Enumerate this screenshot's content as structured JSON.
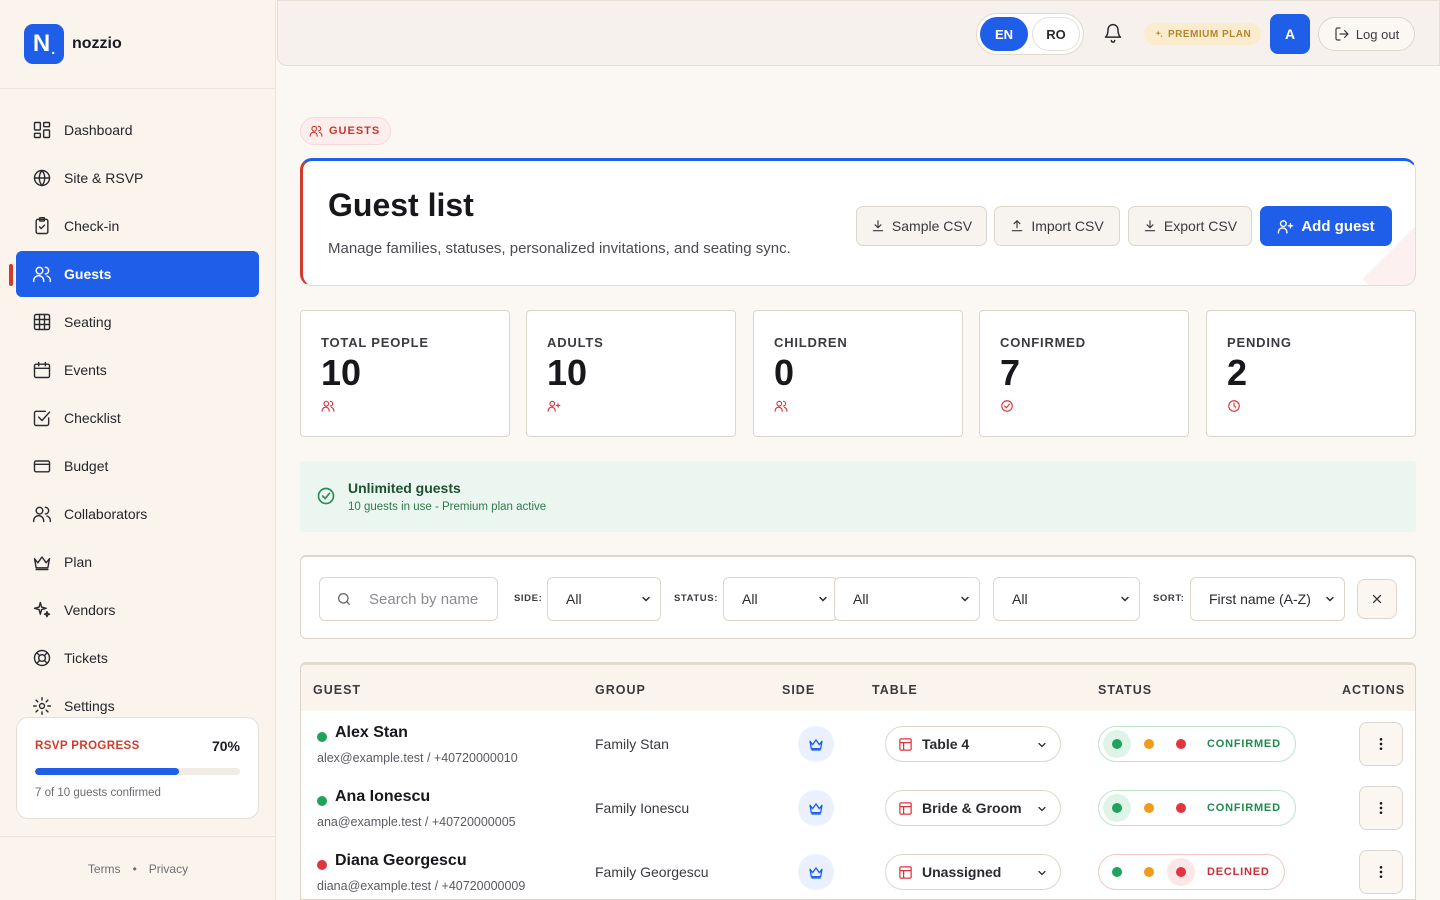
{
  "brand": {
    "logo_letter": "N",
    "name": "nozzio"
  },
  "sidebar": {
    "items": [
      {
        "label": "Dashboard",
        "icon": "dashboard-icon"
      },
      {
        "label": "Site & RSVP",
        "icon": "globe-icon"
      },
      {
        "label": "Check-in",
        "icon": "clipboard-check-icon"
      },
      {
        "label": "Guests",
        "icon": "users-icon",
        "active": true
      },
      {
        "label": "Seating",
        "icon": "grid-icon"
      },
      {
        "label": "Events",
        "icon": "calendar-icon"
      },
      {
        "label": "Checklist",
        "icon": "checkbox-icon"
      },
      {
        "label": "Budget",
        "icon": "wallet-icon"
      },
      {
        "label": "Collaborators",
        "icon": "users-icon"
      },
      {
        "label": "Plan",
        "icon": "crown-icon"
      },
      {
        "label": "Vendors",
        "icon": "sparkles-icon"
      },
      {
        "label": "Tickets",
        "icon": "lifebuoy-icon"
      },
      {
        "label": "Settings",
        "icon": "gear-icon"
      }
    ],
    "rsvp": {
      "label": "RSVP PROGRESS",
      "percent_text": "70%",
      "progress": 0.7,
      "subtitle": "7 of 10 guests confirmed"
    },
    "footer": {
      "terms": "Terms",
      "separator": "•",
      "privacy": "Privacy"
    }
  },
  "topbar": {
    "lang_en": "EN",
    "lang_ro": "RO",
    "premium_badge": "PREMIUM PLAN",
    "avatar_initial": "A",
    "logout_label": "Log out"
  },
  "page": {
    "breadcrumb": "GUESTS",
    "title": "Guest list",
    "subtitle": "Manage families, statuses, personalized invitations, and seating sync.",
    "buttons": {
      "sample_csv": "Sample CSV",
      "import_csv": "Import CSV",
      "export_csv": "Export CSV",
      "add_guest": "Add guest"
    }
  },
  "stats": [
    {
      "label": "TOTAL PEOPLE",
      "value": "10",
      "icon": "users-icon"
    },
    {
      "label": "ADULTS",
      "value": "10",
      "icon": "user-plus-icon"
    },
    {
      "label": "CHILDREN",
      "value": "0",
      "icon": "users-icon"
    },
    {
      "label": "CONFIRMED",
      "value": "7",
      "icon": "check-circle-icon"
    },
    {
      "label": "PENDING",
      "value": "2",
      "icon": "clock-icon"
    }
  ],
  "notice": {
    "title": "Unlimited guests",
    "subtitle": "10 guests in use - Premium plan active"
  },
  "filters": {
    "search_placeholder": "Search by name",
    "side_label": "SIDE:",
    "side_value": "All",
    "status_label": "STATUS:",
    "status_value": "All",
    "filter3_value": "All",
    "filter4_value": "All",
    "sort_label": "SORT:",
    "sort_value": "First name (A-Z)"
  },
  "table": {
    "headers": {
      "guest": "GUEST",
      "group": "GROUP",
      "side": "SIDE",
      "table": "TABLE",
      "status": "STATUS",
      "actions": "ACTIONS"
    },
    "rows": [
      {
        "name": "Alex Stan",
        "contact": "alex@example.test / +40720000010",
        "group": "Family Stan",
        "table": "Table 4",
        "status": "CONFIRMED",
        "dot_color": "#1fa35a"
      },
      {
        "name": "Ana Ionescu",
        "contact": "ana@example.test / +40720000005",
        "group": "Family Ionescu",
        "table": "Bride & Groom",
        "status": "CONFIRMED",
        "dot_color": "#1fa35a"
      },
      {
        "name": "Diana Georgescu",
        "contact": "diana@example.test / +40720000009",
        "group": "Family Georgescu",
        "table": "Unassigned",
        "status": "DECLINED",
        "dot_color": "#e0353f"
      }
    ]
  },
  "colors": {
    "accent": "#1f5ee8",
    "brand_red": "#d23b2c",
    "confirmed": "#1fa35a",
    "pending": "#f29a1a",
    "declined": "#e0353f"
  }
}
